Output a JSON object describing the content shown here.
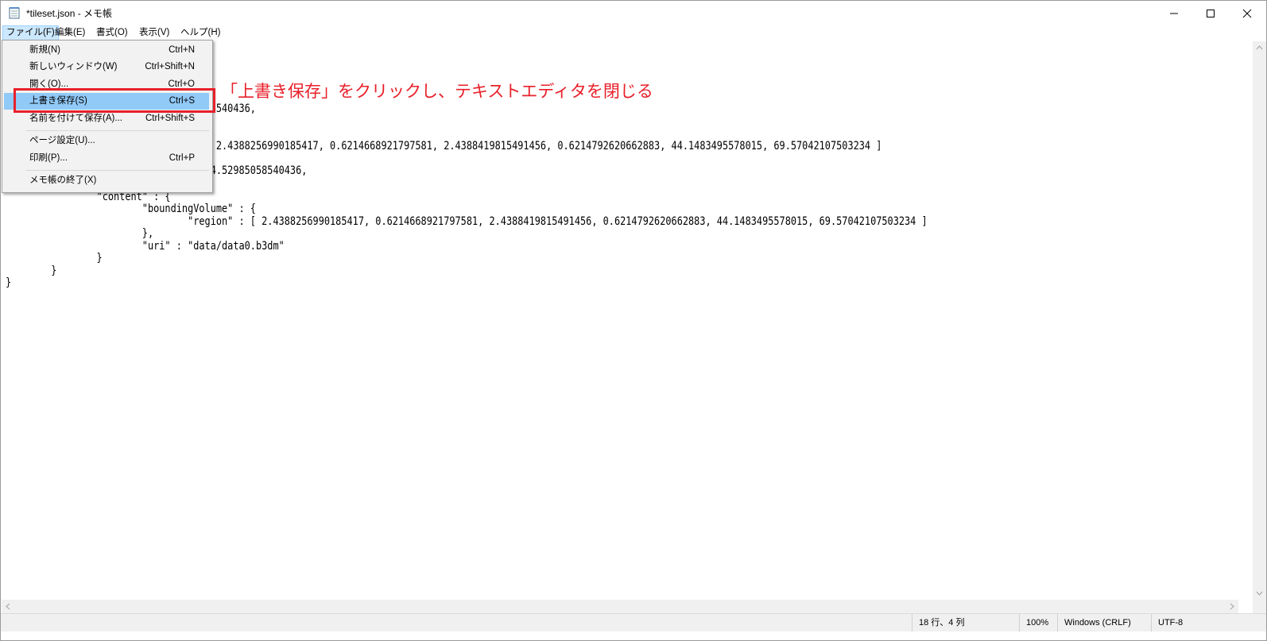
{
  "window": {
    "title": "*tileset.json - メモ帳",
    "controls": {
      "minimize": "minimize",
      "maximize": "maximize",
      "close": "close"
    }
  },
  "menubar": [
    {
      "label": "ファイル(F)"
    },
    {
      "label": "編集(E)"
    },
    {
      "label": "書式(O)"
    },
    {
      "label": "表示(V)"
    },
    {
      "label": "ヘルプ(H)"
    }
  ],
  "file_menu": {
    "items": [
      {
        "label": "新規(N)",
        "shortcut": "Ctrl+N"
      },
      {
        "label": "新しいウィンドウ(W)",
        "shortcut": "Ctrl+Shift+N"
      },
      {
        "label": "開く(O)...",
        "shortcut": "Ctrl+O"
      },
      {
        "label": "上書き保存(S)",
        "shortcut": "Ctrl+S"
      },
      {
        "label": "名前を付けて保存(A)...",
        "shortcut": "Ctrl+Shift+S"
      },
      {
        "label": "ページ設定(U)...",
        "shortcut": ""
      },
      {
        "label": "印刷(P)...",
        "shortcut": "Ctrl+P"
      },
      {
        "label": "メモ帳の終了(X)",
        "shortcut": ""
      }
    ],
    "highlighted_item": "上書き保存(S)"
  },
  "annotation": {
    "text": "「上書き保存」をクリックし、テキストエディタを閉じる",
    "color": "#e8202a"
  },
  "editor": {
    "lines": [
      "                                 5058540436,",
      "                                 : [",
      "                                 : [ 2.4388256990185417, 0.6214668921797581, 2.4388419815491456, 0.6214792620662883, 44.1483495578015, 69.57042107503234 ]",
      "                                 : 84.52985058540436,",
      "                \"content\" : {",
      "                        \"boundingVolume\" : {",
      "                                \"region\" : [ 2.4388256990185417, 0.6214668921797581, 2.4388419815491456, 0.6214792620662883, 44.1483495578015, 69.57042107503234 ]",
      "                        },",
      "                        \"uri\" : \"data/data0.b3dm\"",
      "                }",
      "        }",
      "}"
    ]
  },
  "statusbar": {
    "position": "18 行、4 列",
    "zoom": "100%",
    "line_ending": "Windows (CRLF)",
    "encoding": "UTF-8"
  }
}
